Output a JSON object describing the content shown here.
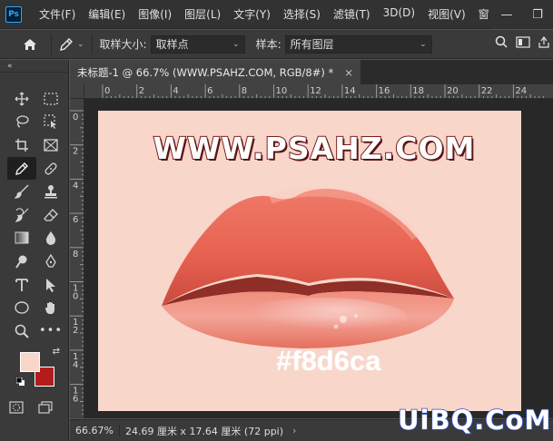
{
  "app": {
    "logo": "Ps"
  },
  "menu": [
    "文件(F)",
    "编辑(E)",
    "图像(I)",
    "图层(L)",
    "文字(Y)",
    "选择(S)",
    "滤镜(T)",
    "3D(D)",
    "视图(V)",
    "窗"
  ],
  "window_controls": {
    "minimize": "—",
    "restore": "❐"
  },
  "options": {
    "sample_size_label": "取样大小:",
    "sample_size_value": "取样点",
    "sample_label": "样本:",
    "sample_value": "所有图层"
  },
  "document": {
    "tab_title": "未标题-1 @ 66.7% (WWW.PSAHZ.COM, RGB/8#) *",
    "close": "×"
  },
  "ruler_h_labels": [
    "0",
    "2",
    "4",
    "6",
    "8",
    "10",
    "12",
    "14",
    "16",
    "18",
    "20",
    "22",
    "24"
  ],
  "ruler_v_labels": [
    "0",
    "2",
    "4",
    "6",
    "8",
    "10",
    "12",
    "14",
    "16"
  ],
  "canvas": {
    "background": "#f8d6ca",
    "headline": "WWW.PSAHZ.COM",
    "color_code": "#f8d6ca"
  },
  "colors": {
    "foreground": "#f8d6ca",
    "background": "#b31c1c",
    "accent_blue": "#2a52d6"
  },
  "status": {
    "zoom": "66.67%",
    "info": "24.69 厘米 x 17.64 厘米 (72 ppi)",
    "arrow": "›"
  },
  "watermark": "UiBQ.CoM"
}
